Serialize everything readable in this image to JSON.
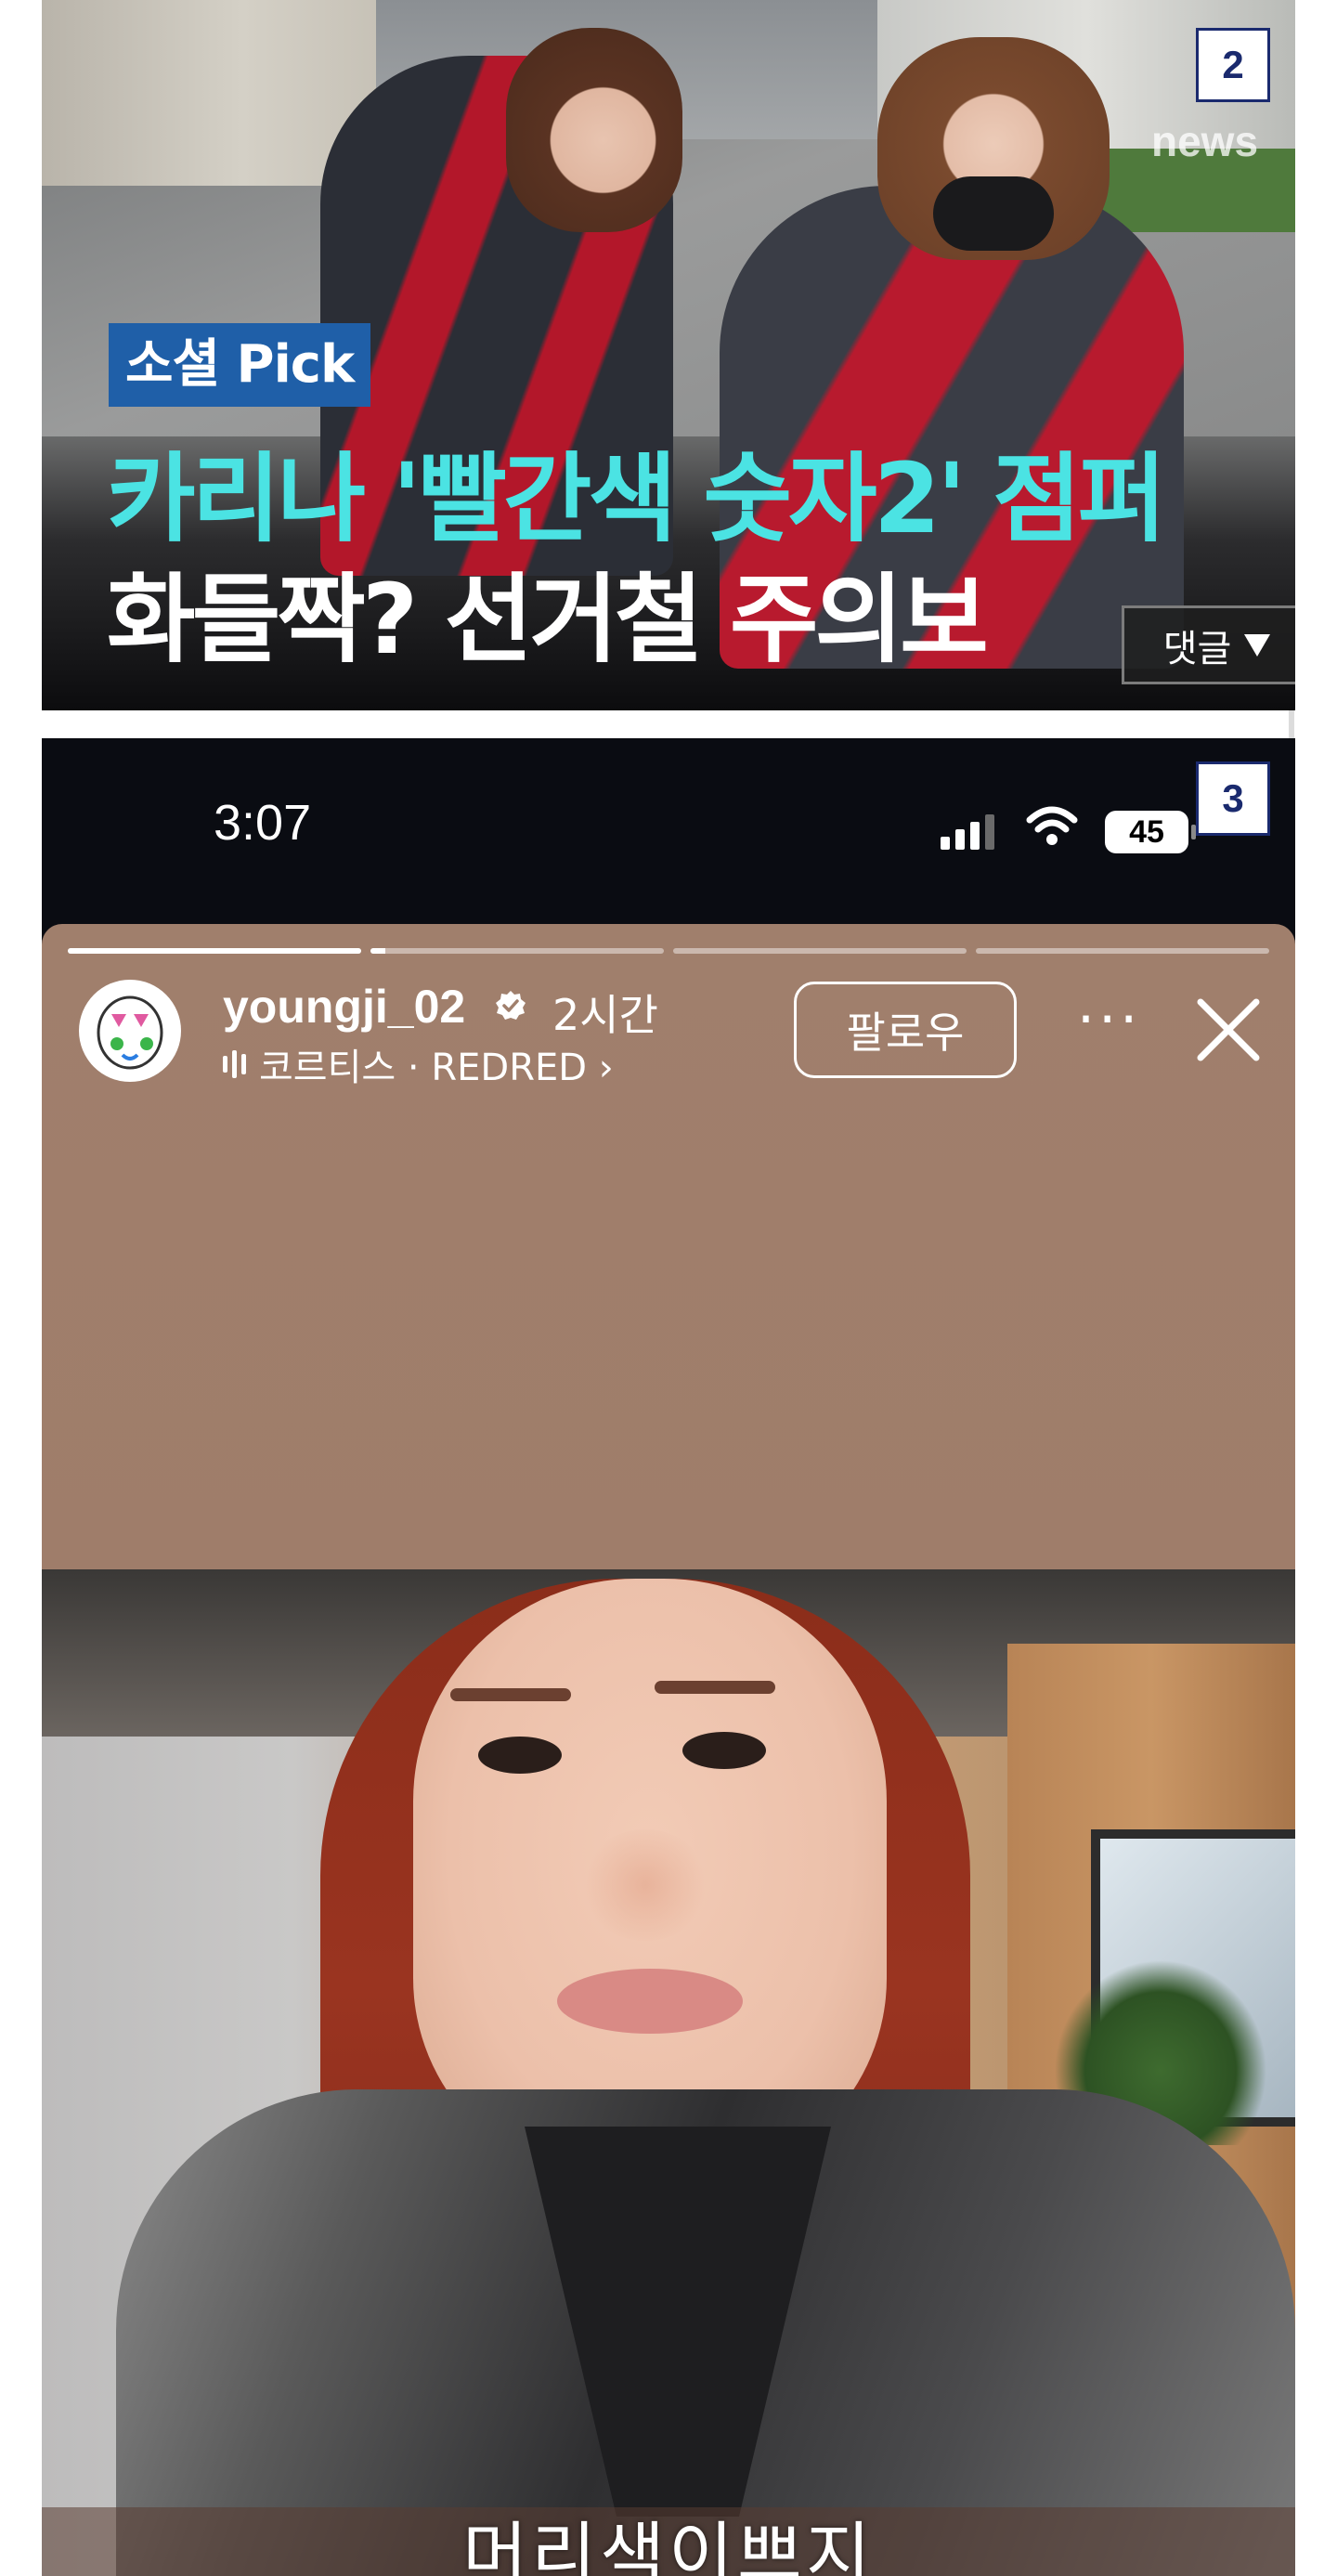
{
  "panel2": {
    "badge": "2",
    "broadcaster_logo": "news",
    "tag": "소셜 Pick",
    "headline_line1": "카리나 '빨간색 숫자2' 점퍼",
    "headline_line2": "화들짝? 선거철 주의보",
    "comment_button": "댓글",
    "comment_icon": "triangle-down-icon"
  },
  "panel3": {
    "badge": "3",
    "status": {
      "time": "3:07",
      "battery": "45",
      "signal_icon": "signal-icon",
      "wifi_icon": "wifi-icon"
    },
    "story": {
      "progress": [
        1.0,
        0.05,
        0,
        0
      ],
      "username": "youngji_02",
      "verified_icon": "verified-badge-icon",
      "age": "2시간",
      "music": "코르티스 · REDRED ›",
      "follow_label": "팔로우",
      "more_label": "···",
      "close_icon": "close-icon",
      "caption": "머리색이쁘지"
    }
  },
  "colors": {
    "headline_cyan": "#4be3e3",
    "tag_blue": "#1f5fa8",
    "badge_navy": "#1a2a6e",
    "story_bg": "#a07f6c"
  }
}
